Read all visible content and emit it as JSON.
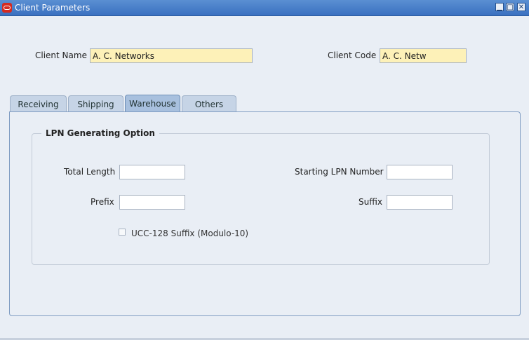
{
  "window": {
    "title": "Client Parameters",
    "controls": {
      "minimize": "▁",
      "maximize": "□",
      "close": "✕"
    }
  },
  "header": {
    "client_name_label": "Client Name",
    "client_name_value": "A. C. Networks",
    "client_code_label": "Client Code",
    "client_code_value": "A. C. Netw"
  },
  "tabs": [
    {
      "label": "Receiving"
    },
    {
      "label": "Shipping"
    },
    {
      "label": "Warehouse",
      "active": true
    },
    {
      "label": "Others"
    }
  ],
  "lpn_group": {
    "title": "LPN Generating Option",
    "total_length_label": "Total Length",
    "total_length_value": "",
    "starting_lpn_label": "Starting LPN Number",
    "starting_lpn_value": "",
    "prefix_label": "Prefix",
    "prefix_value": "",
    "suffix_label": "Suffix",
    "suffix_value": "",
    "ucc_label": "UCC-128 Suffix (Modulo-10)",
    "ucc_checked": false
  },
  "colors": {
    "titlebar": "#3a70c0",
    "required_field": "#fdf1b8",
    "background": "#e9eef5"
  }
}
